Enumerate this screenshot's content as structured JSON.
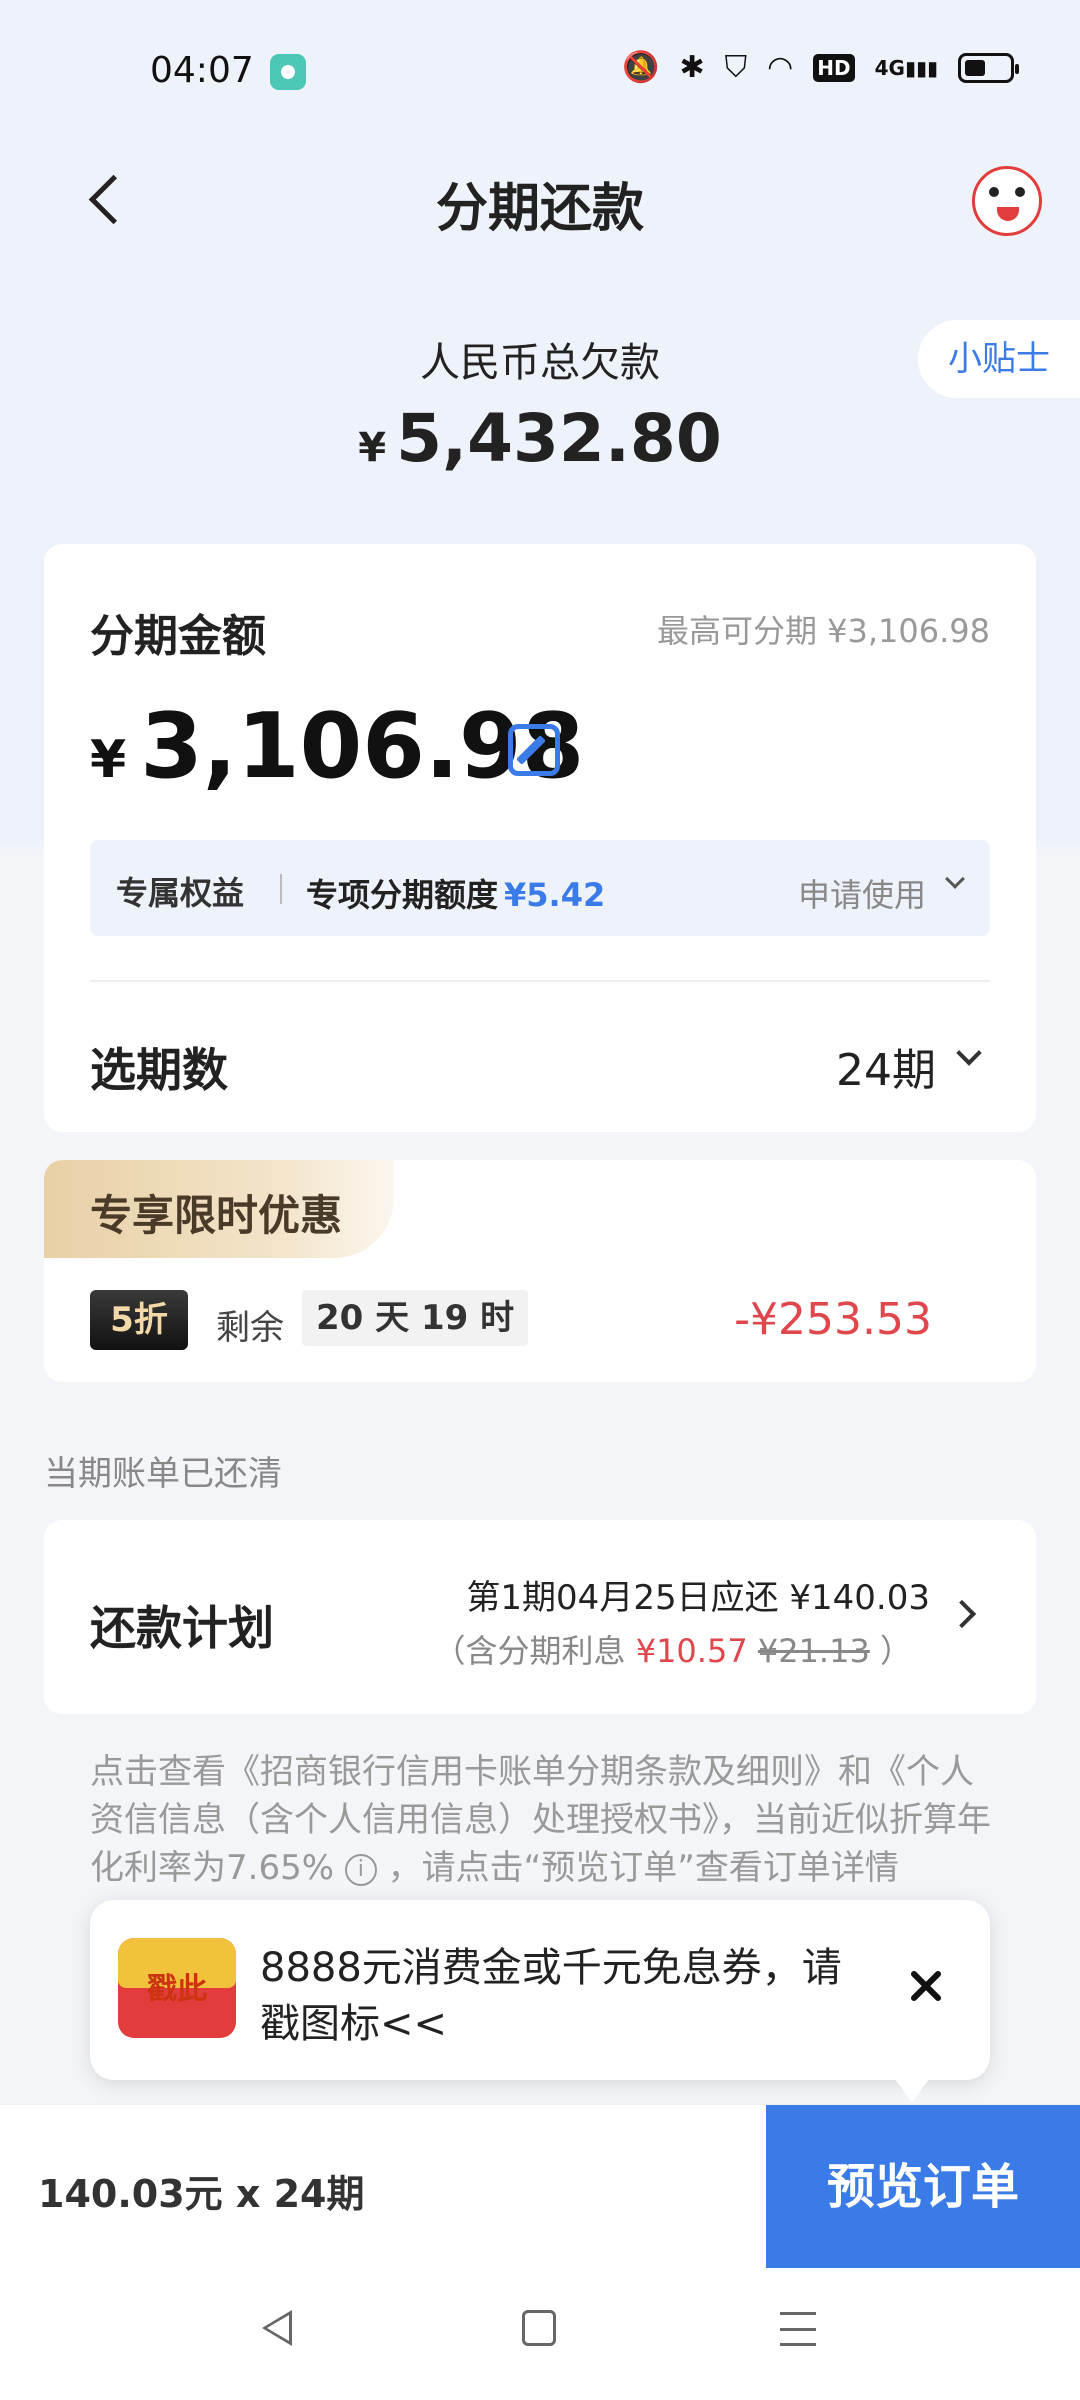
{
  "status_bar": {
    "time": "04:07",
    "icons": [
      "mute-icon",
      "bluetooth-icon",
      "shield-icon",
      "wifi-icon",
      "hd-icon",
      "signal-4g-icon",
      "battery-icon"
    ],
    "hd": "HD",
    "network": "4G"
  },
  "header": {
    "title": "分期还款",
    "back_icon": "chevron-left-icon",
    "mascot_icon": "mascot-avatar-icon"
  },
  "summary": {
    "label": "人民币总欠款",
    "currency": "¥",
    "amount": "5,432.80",
    "tips_button": "小贴士"
  },
  "installment": {
    "title": "分期金额",
    "max_label": "最高可分期 ¥3,106.98",
    "currency": "¥",
    "amount": "3,106.98",
    "edit_icon": "edit-icon",
    "benefit": {
      "tag": "专属权益",
      "text": "专项分期额度",
      "value": "¥5.42",
      "action": "申请使用"
    },
    "period_label": "选期数",
    "period_value": "24期"
  },
  "promo": {
    "title": "专享限时优惠",
    "discount": "5折",
    "remain_label": "剩余",
    "remain_time": "20 天 19 时",
    "saving": "-¥253.53"
  },
  "bill_status": "当期账单已还清",
  "plan": {
    "title": "还款计划",
    "line1": "第1期04月25日应还 ¥140.03",
    "line2_prefix": "（含分期利息",
    "interest": "¥10.57",
    "original_interest": "¥21.13",
    "line2_suffix": "）"
  },
  "terms": {
    "text_before": "点击查看《招商银行信用卡账单分期条款及细则》和《个人资信信息（含个人信用信息）处理授权书》，当前近似折算年化利率为7.65%",
    "info_icon": "i",
    "text_after": "，请点击“预览订单”查看订单详情"
  },
  "popup": {
    "icon_label": "戳此",
    "text": "8888元消费金或千元免息券，请戳图标<<"
  },
  "footer": {
    "summary": "140.03元 x 24期",
    "preview_button": "预览订单"
  }
}
